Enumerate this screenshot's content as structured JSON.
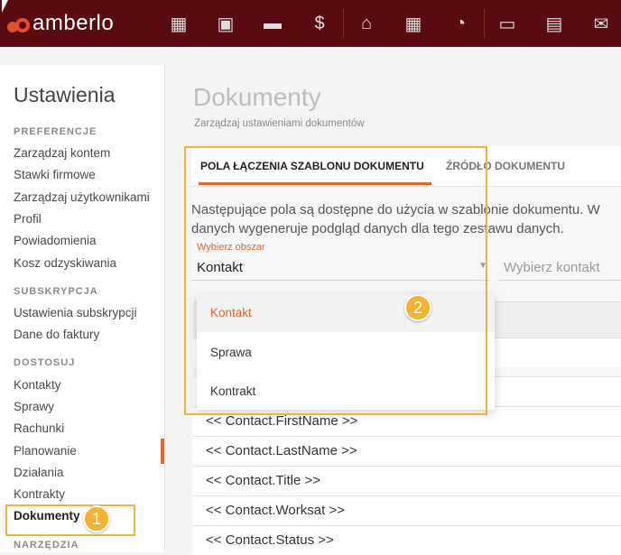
{
  "app": {
    "name": "amberlo"
  },
  "topnav": {
    "icons": [
      "dashboard-icon",
      "contacts-icon",
      "matters-icon",
      "invoice-icon",
      "bank-icon",
      "calendar-icon",
      "time-icon",
      "folder-icon",
      "document-icon",
      "mail-icon"
    ],
    "glyphs": [
      "▦",
      "▣",
      "▬",
      "$",
      "⌂",
      "▦",
      "◔",
      "▭",
      "▤",
      "✉"
    ]
  },
  "sidebar": {
    "title": "Ustawienia",
    "sections": [
      {
        "label": "PREFERENCJE",
        "items": [
          "Zarządzaj kontem",
          "Stawki firmowe",
          "Zarządzaj użytkownikami",
          "Profil",
          "Powiadomienia",
          "Kosz odzyskiwania"
        ]
      },
      {
        "label": "SUBSKRYPCJA",
        "items": [
          "Ustawienia subskrypcji",
          "Dane do faktury"
        ]
      },
      {
        "label": "DOSTOSUJ",
        "items": [
          "Kontakty",
          "Sprawy",
          "Rachunki",
          "Planowanie",
          "Działania",
          "Kontrakty",
          "Dokumenty"
        ]
      },
      {
        "label": "NARZĘDZIA",
        "items": []
      }
    ],
    "active_item": "Dokumenty"
  },
  "main": {
    "title": "Dokumenty",
    "subtitle": "Zarządzaj ustawieniami dokumentów",
    "tabs": [
      {
        "label": "POLA ŁĄCZENIA SZABLONU DOKUMENTU",
        "active": true
      },
      {
        "label": "ŹRÓDŁO DOKUMENTU",
        "active": false
      }
    ],
    "description_line1": "Następujące pola są dostępne do użycia w szablonie dokumentu. W",
    "description_line2": "danych wygeneruje podgląd danych dla tego zestawu danych.",
    "area_select": {
      "label": "Wybierz obszar",
      "value": "Kontakt"
    },
    "contact_select": {
      "placeholder": "Wybierz kontakt"
    },
    "dropdown_options": [
      "Kontakt",
      "Sprawa",
      "Kontrakt"
    ],
    "fields": [
      "<< Contact.FirstName >>",
      "<< Contact.LastName >>",
      "<< Contact.Title >>",
      "<< Contact.Worksat >>",
      "<< Contact.Status >>"
    ]
  },
  "annotations": {
    "badge1": "1",
    "badge2": "2"
  },
  "colors": {
    "topbar": "#5a0b12",
    "accent": "#e2672c",
    "highlight": "#f2b33d"
  }
}
